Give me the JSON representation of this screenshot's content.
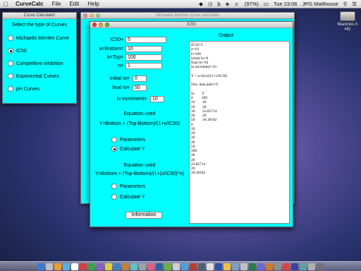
{
  "menubar": {
    "app_name": "CurveCalc",
    "menus": [
      "File",
      "Edit",
      "Help"
    ],
    "battery": "(97%)",
    "clock": "Tue 23:06",
    "user": "JPG Malthouse"
  },
  "desktop": {
    "hd_label": "Macintos h HD"
  },
  "curve_calc_window": {
    "title": "Curve Calculator",
    "prompt": "Select the type of Curves",
    "options": [
      {
        "label": "Michaelis Menten Curve",
        "selected": false
      },
      {
        "label": "IC50",
        "selected": true
      },
      {
        "label": "Competitive inhibition",
        "selected": false
      },
      {
        "label": "Exponential Curves",
        "selected": false
      },
      {
        "label": "pH Curves",
        "selected": false
      }
    ]
  },
  "mm_window": {
    "title": "Michaelis Menton curve calculator"
  },
  "ic50_window": {
    "title": "IC50",
    "fields": {
      "ic50": {
        "label": "IC50=",
        "value": "5"
      },
      "bottom": {
        "label": "a=Bottom=",
        "value": "10"
      },
      "top": {
        "label": "b=Top=",
        "value": "100"
      },
      "n": {
        "label": "n=",
        "value": "1"
      },
      "initial_io": {
        "label": "Initial Io=",
        "value": "0"
      },
      "final_io": {
        "label": "final Io=",
        "value": "50"
      },
      "io_increment": {
        "label": "Io increment=",
        "value": "10"
      }
    },
    "equation1": {
      "heading": "Equation used",
      "formula": "Y=Bottom + (Top-Bottom)/(1+x/IC50)",
      "radios": [
        {
          "label": "Parameters",
          "selected": false
        },
        {
          "label": "Calculate Y",
          "selected": true
        }
      ]
    },
    "equation2": {
      "heading": "Equation used",
      "formula": "Y=Bottom + (Top-Bottom)/(1+(x/IC50)^n)",
      "radios": [
        {
          "label": "Parameters",
          "selected": false
        },
        {
          "label": "Calculate Y",
          "selected": false
        }
      ]
    },
    "information_button": "Information",
    "output_label": "Output",
    "output_lines": [
      "IC50=5",
      "a=10",
      "b=100",
      "initial Io=0",
      "final Io=50",
      "Io increment=10",
      "",
      "Y = a+(b-a)/(1+x/IC50)",
      "",
      "Nos. data pairs=6",
      "",
      "Io        Y",
      "0         100",
      "10        40",
      "20        28",
      "30        22.85714",
      "40        20",
      "50        18.18182",
      "0",
      "10",
      "20",
      "30",
      "40",
      "50",
      "100",
      "40",
      "28",
      "22.85714",
      "20",
      "18.18182"
    ]
  },
  "dock": {
    "colors": [
      "#3a7bd5",
      "#c0c0c0",
      "#e8a030",
      "#5ab0e0",
      "#ffffff",
      "#d04040",
      "#40a050",
      "#8a60c0",
      "#e0d040",
      "#4080c0",
      "#c08040",
      "#60c0c0",
      "#a0a0a0",
      "#e06080",
      "#3060a0",
      "#70b040",
      "#d0d0d0",
      "#4aa0e0",
      "#b04030",
      "#506070",
      "#e0e0e0",
      "#3050b0",
      "#f0c040",
      "#80a0c0",
      "#c0c0c0",
      "#2a7a4a",
      "#6a6ad0",
      "#d07a30",
      "#909090",
      "#e04040",
      "#4040a0",
      "#60a0a0",
      "#b0b0b0",
      "#70707a"
    ]
  }
}
